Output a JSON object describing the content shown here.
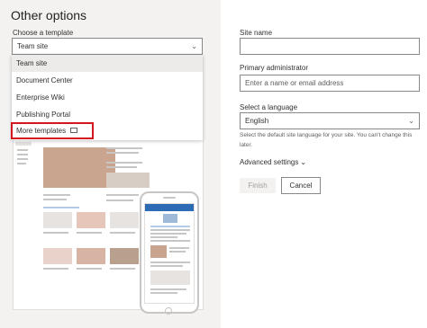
{
  "left": {
    "heading": "Other options",
    "template_label": "Choose a template",
    "template_selected": "Team site",
    "dropdown_items": [
      "Team site",
      "Document Center",
      "Enterprise Wiki",
      "Publishing Portal",
      "More templates"
    ]
  },
  "form": {
    "site_name_label": "Site name",
    "site_name_value": "",
    "admin_label": "Primary administrator",
    "admin_placeholder": "Enter a name or email address",
    "language_label": "Select a language",
    "language_selected": "English",
    "language_description": "Select the default site language for your site. You can't change this later.",
    "advanced_label": "Advanced settings",
    "finish_label": "Finish",
    "cancel_label": "Cancel"
  },
  "colors": {
    "highlight_border": "#d4171f",
    "phone_header": "#2d6cb5",
    "panel_background": "#f3f2f1"
  },
  "icons": {
    "template_chevron": "chevron-down-icon",
    "language_chevron": "chevron-down-icon",
    "advanced_chevron": "chevron-down-icon",
    "more_templates": "open-external-icon"
  }
}
